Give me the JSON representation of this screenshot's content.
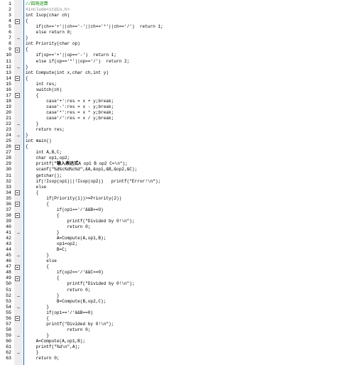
{
  "editor": {
    "line_numbers": [
      "1",
      "2",
      "3",
      "4",
      "5",
      "6",
      "7",
      "8",
      "9",
      "10",
      "11",
      "12",
      "13",
      "14",
      "15",
      "16",
      "17",
      "18",
      "19",
      "20",
      "21",
      "22",
      "23",
      "24",
      "25",
      "26",
      "27",
      "28",
      "29",
      "30",
      "31",
      "32",
      "33",
      "34",
      "35",
      "36",
      "37",
      "38",
      "39",
      "40",
      "41",
      "42",
      "43",
      "44",
      "45",
      "46",
      "47",
      "48",
      "49",
      "50",
      "51",
      "52",
      "53",
      "54",
      "55",
      "56",
      "57",
      "58",
      "59",
      "60",
      "61",
      "62",
      "63"
    ],
    "lines": [
      {
        "segs": [
          {
            "t": "//四则运算",
            "c": "comment"
          }
        ]
      },
      {
        "segs": [
          {
            "t": "#include<stdio.h>",
            "c": "pre"
          }
        ]
      },
      {
        "segs": [
          {
            "t": "int Isop(char ch)"
          }
        ]
      },
      {
        "segs": [
          {
            "t": "{"
          }
        ]
      },
      {
        "segs": [
          {
            "t": "    if(ch=='+'||ch=='-'||ch=='*'||ch=='/')  return 1;"
          }
        ]
      },
      {
        "segs": [
          {
            "t": "    else return 0;"
          }
        ]
      },
      {
        "segs": [
          {
            "t": "}"
          }
        ]
      },
      {
        "segs": [
          {
            "t": "int Priority(char op)"
          }
        ]
      },
      {
        "segs": [
          {
            "t": "{"
          }
        ]
      },
      {
        "segs": [
          {
            "t": "    if(op=='+'||op=='-')  return 1;"
          }
        ]
      },
      {
        "segs": [
          {
            "t": "    else if(op=='*'||op=='/')  return 2;"
          }
        ]
      },
      {
        "segs": [
          {
            "t": "}"
          }
        ]
      },
      {
        "segs": [
          {
            "t": "int Compute(int x,char ch,int y)"
          }
        ]
      },
      {
        "segs": [
          {
            "t": "{"
          }
        ]
      },
      {
        "segs": [
          {
            "t": "    int res;"
          }
        ]
      },
      {
        "segs": [
          {
            "t": "    switch(ch)"
          }
        ]
      },
      {
        "segs": [
          {
            "t": "    {"
          }
        ]
      },
      {
        "segs": [
          {
            "t": "        case'+':res = x + y;break;"
          }
        ]
      },
      {
        "segs": [
          {
            "t": "        case'-':res = x - y;break;"
          }
        ]
      },
      {
        "segs": [
          {
            "t": "        case'*':res = x * y;break;"
          }
        ]
      },
      {
        "segs": [
          {
            "t": "        case'/':res = x / y;break;"
          }
        ]
      },
      {
        "segs": [
          {
            "t": "    }"
          }
        ]
      },
      {
        "segs": [
          {
            "t": "    return res;"
          }
        ]
      },
      {
        "segs": [
          {
            "t": "}"
          }
        ]
      },
      {
        "segs": [
          {
            "t": "int main()"
          }
        ]
      },
      {
        "segs": [
          {
            "t": "{"
          }
        ]
      },
      {
        "segs": [
          {
            "t": "    int A,B,C;"
          }
        ]
      },
      {
        "segs": [
          {
            "t": "    char op1,op2;"
          }
        ]
      },
      {
        "segs": [
          {
            "t": "    printf(\""
          },
          {
            "t": "输入表达式",
            "c": "bold"
          },
          {
            "t": "A op1 B op2 C=\\n\");"
          }
        ]
      },
      {
        "segs": [
          {
            "t": "    scanf(\"%d%c%d%c%d\",&A,&op1,&B,&op2,&C);"
          }
        ]
      },
      {
        "segs": [
          {
            "t": "    getchar();"
          }
        ]
      },
      {
        "segs": [
          {
            "t": "    if(!Isop(op1)||!Isop(op2))   printf(\"Error!\\n\");"
          }
        ]
      },
      {
        "segs": [
          {
            "t": "    else"
          }
        ]
      },
      {
        "segs": [
          {
            "t": "    {"
          }
        ]
      },
      {
        "segs": [
          {
            "t": "        if(Priority(1))>=Priority(2))"
          }
        ]
      },
      {
        "segs": [
          {
            "t": "        {"
          }
        ]
      },
      {
        "segs": [
          {
            "t": "            if(op1=='/'&&B==0)"
          }
        ]
      },
      {
        "segs": [
          {
            "t": "            {"
          }
        ]
      },
      {
        "segs": [
          {
            "t": "                printf(\"Divided by 0!\\n\");"
          }
        ]
      },
      {
        "segs": [
          {
            "t": "                return 0;"
          }
        ]
      },
      {
        "segs": [
          {
            "t": "            }"
          }
        ]
      },
      {
        "segs": [
          {
            "t": "            A=Compute(A,op1,B);"
          }
        ]
      },
      {
        "segs": [
          {
            "t": "            op1=op2;"
          }
        ]
      },
      {
        "segs": [
          {
            "t": "            B=C;"
          }
        ]
      },
      {
        "segs": [
          {
            "t": "        }"
          }
        ]
      },
      {
        "segs": [
          {
            "t": "        else"
          }
        ]
      },
      {
        "segs": [
          {
            "t": "        {"
          }
        ]
      },
      {
        "segs": [
          {
            "t": "            if(op2=='/'&&C==0)"
          }
        ]
      },
      {
        "segs": [
          {
            "t": "            {"
          }
        ]
      },
      {
        "segs": [
          {
            "t": "                printf(\"Divided by 0!\\n\");"
          }
        ]
      },
      {
        "segs": [
          {
            "t": "                return 0;"
          }
        ]
      },
      {
        "segs": [
          {
            "t": "            }"
          }
        ]
      },
      {
        "segs": [
          {
            "t": "            B=Compute(B,op2,C);"
          }
        ]
      },
      {
        "segs": [
          {
            "t": "        }"
          }
        ]
      },
      {
        "segs": [
          {
            "t": "        if(op1=='/'&&B==0)"
          }
        ]
      },
      {
        "segs": [
          {
            "t": "        {"
          }
        ]
      },
      {
        "segs": [
          {
            "t": "        printf(\"Divided by 0!\\n\");"
          }
        ]
      },
      {
        "segs": [
          {
            "t": "                return 0;"
          }
        ]
      },
      {
        "segs": [
          {
            "t": "        }"
          }
        ]
      },
      {
        "segs": [
          {
            "t": "    A=Compute(A,op1,B);"
          }
        ]
      },
      {
        "segs": [
          {
            "t": "    printf(\"%d\\n\",A);"
          }
        ]
      },
      {
        "segs": [
          {
            "t": "    }"
          }
        ]
      },
      {
        "segs": [
          {
            "t": "    return 0;"
          }
        ]
      }
    ],
    "fold_open_lines": [
      4,
      9,
      14,
      17,
      26,
      34,
      36,
      38,
      47,
      49,
      56
    ],
    "fold_close_lines": [
      7,
      12,
      22,
      24,
      41,
      45,
      52,
      54,
      59,
      62
    ],
    "colors": {
      "comment": "#008000",
      "preprocessor": "#808080",
      "text": "#000000",
      "fold_margin": "#ededed",
      "caret_line": "#2060c0"
    }
  }
}
